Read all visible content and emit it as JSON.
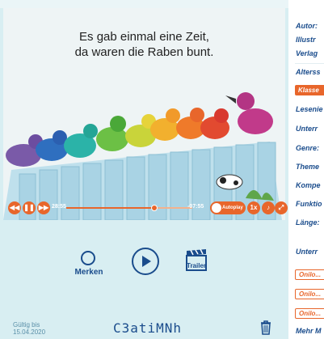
{
  "book": {
    "caption_line1": "Es gab einmal eine Zeit,",
    "caption_line2": "da waren die Raben bunt."
  },
  "player": {
    "elapsed": "28:55",
    "remaining": "-07:55",
    "autoplay_label": "Autoplay",
    "progress": 0.7,
    "speed_label": "1x"
  },
  "controls": {
    "merken_label": "Merken",
    "trailer_label": "Trailer"
  },
  "footer": {
    "valid_line1": "Gültig bis",
    "valid_line2": "15.04.2020",
    "code": "C3atiMNh"
  },
  "details": {
    "labels": [
      "Autor:",
      "Illustr",
      "Verlag",
      "Alterss",
      "Lesenie",
      "Unterr",
      "Genre:",
      "Theme",
      "Kompe",
      "Funktio",
      "Länge:",
      "Unterr"
    ],
    "class_tag": "Klasse",
    "onilo_pills": [
      "Onilo...",
      "Onilo...",
      "Onilo..."
    ],
    "more_link": "Mehr M"
  },
  "colors": {
    "accent": "#e8662b",
    "text_blue": "#1a4c8c",
    "card_bg": "#d8eef2"
  }
}
